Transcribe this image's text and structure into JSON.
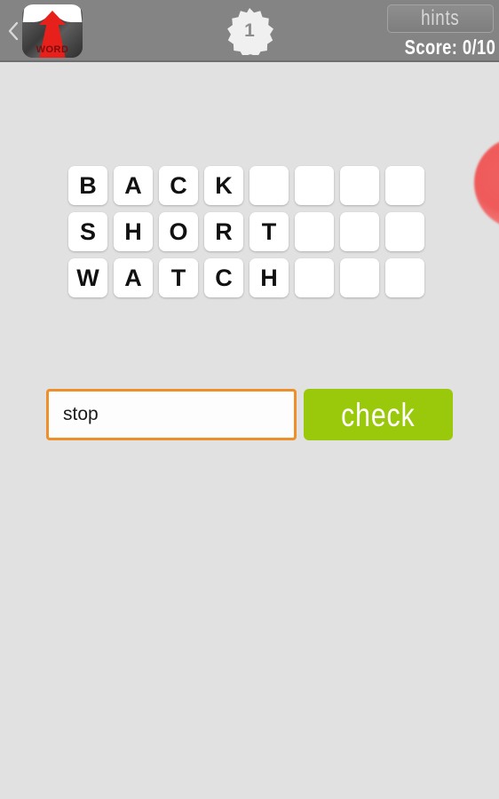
{
  "header": {
    "back_icon": "chevron-left-icon",
    "app_icon": {
      "name": "word-game-app-icon",
      "label": "WORD"
    },
    "level_badge": {
      "name": "level-badge",
      "value": "1"
    },
    "hints_label": "hints",
    "score_label": "Score: 0/10"
  },
  "decor": {
    "blob": "red-circle-decoration"
  },
  "grid": {
    "rows": [
      {
        "word": "BACK",
        "cells": [
          "B",
          "A",
          "C",
          "K",
          "",
          "",
          "",
          ""
        ]
      },
      {
        "word": "SHORT",
        "cells": [
          "S",
          "H",
          "O",
          "R",
          "T",
          "",
          "",
          ""
        ]
      },
      {
        "word": "WATCH",
        "cells": [
          "W",
          "A",
          "T",
          "C",
          "H",
          "",
          "",
          ""
        ]
      }
    ]
  },
  "answer": {
    "value": "stop",
    "placeholder": "",
    "check_label": "check"
  },
  "colors": {
    "header_bg": "#848484",
    "page_bg": "#e1e1e1",
    "accent_orange": "#ef8f2a",
    "accent_green": "#9ac90c",
    "tile_bg": "#ffffff",
    "blob_red": "#ef5a5a"
  }
}
